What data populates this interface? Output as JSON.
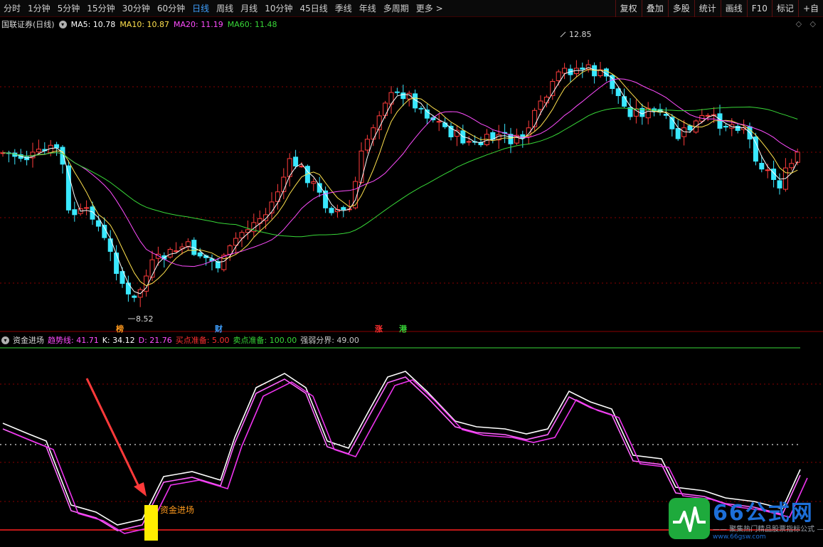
{
  "toolbar": {
    "timeframes": [
      "分时",
      "1分钟",
      "5分钟",
      "15分钟",
      "30分钟",
      "60分钟",
      "日线",
      "周线",
      "月线",
      "10分钟",
      "45日线",
      "季线",
      "年线",
      "多周期",
      "更多"
    ],
    "active": "日线",
    "tools": [
      "复权",
      "叠加",
      "多股",
      "统计",
      "画线",
      "F10",
      "标记",
      "+自"
    ]
  },
  "price_panel": {
    "stock": "国联证券(日线)",
    "ma": [
      {
        "label": "MA5: 10.78",
        "color": "#ffffff"
      },
      {
        "label": "MA10: 10.87",
        "color": "#ffe14d"
      },
      {
        "label": "MA20: 11.19",
        "color": "#ff4dff"
      },
      {
        "label": "MA60: 11.48",
        "color": "#38d838"
      }
    ],
    "high_label": "12.85",
    "low_label": "8.52",
    "corner": "◇ ◇"
  },
  "badges": [
    {
      "text": "榜",
      "color": "#ff9a1e"
    },
    {
      "text": "财",
      "color": "#3fa0ff"
    },
    {
      "text": "涨",
      "color": "#ff3030"
    },
    {
      "text": "港",
      "color": "#38d838"
    }
  ],
  "indicator_panel": {
    "name": "资金进场",
    "values": [
      {
        "label": "趋势线: 41.71",
        "color": "#ff4dff"
      },
      {
        "label": "K: 34.12",
        "color": "#ffffff"
      },
      {
        "label": "D: 21.76",
        "color": "#ff4dff"
      },
      {
        "label": "买点准备: 5.00",
        "color": "#ff3030"
      },
      {
        "label": "卖点准备: 100.00",
        "color": "#38d838"
      },
      {
        "label": "强弱分界: 49.00",
        "color": "#c8c8c8"
      }
    ],
    "signal_label": "资金进场"
  },
  "watermark": {
    "title": "66公式网",
    "subtitle": "—— 聚集热门精品股票指标公式 ——",
    "url": "www.66gsw.com"
  },
  "colors": {
    "up": "#ff3c3c",
    "down": "#3ae8ff",
    "ma5": "#ffffff",
    "ma10": "#ffe14d",
    "ma20": "#ff4dff",
    "ma60": "#38d838",
    "grid": "#8a0000"
  }
}
